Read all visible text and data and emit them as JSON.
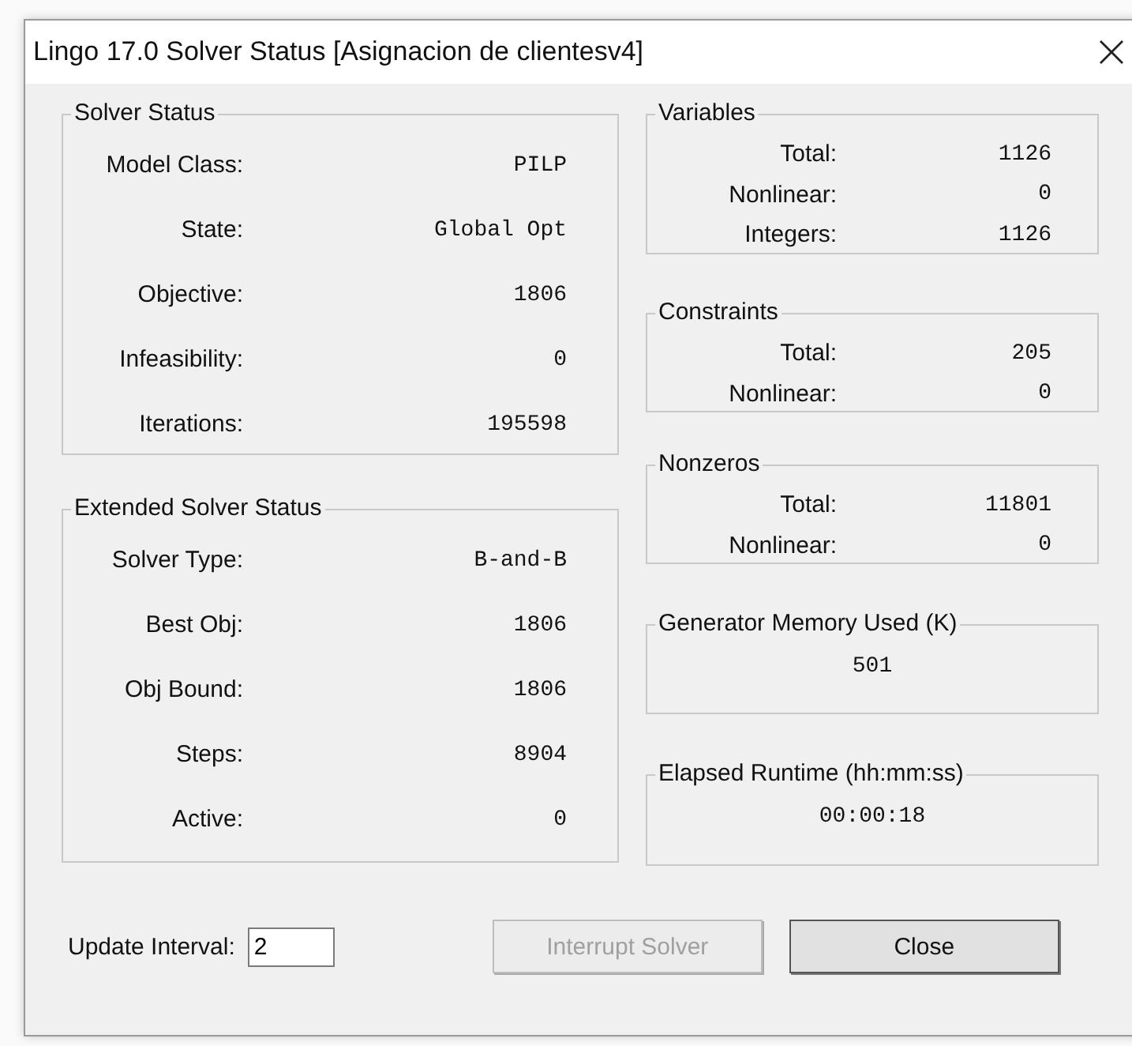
{
  "window": {
    "title": "Lingo 17.0 Solver Status [Asignacion de clientesv4]"
  },
  "left_groups": [
    {
      "title": "Solver Status",
      "rows": [
        {
          "label": "Model Class:",
          "value": "PILP"
        },
        {
          "label": "State:",
          "value": "Global Opt"
        },
        {
          "label": "Objective:",
          "value": "1806"
        },
        {
          "label": "Infeasibility:",
          "value": "0"
        },
        {
          "label": "Iterations:",
          "value": "195598"
        }
      ]
    },
    {
      "title": "Extended Solver Status",
      "rows": [
        {
          "label": "Solver Type:",
          "value": "B-and-B"
        },
        {
          "label": "Best Obj:",
          "value": "1806"
        },
        {
          "label": "Obj Bound:",
          "value": "1806"
        },
        {
          "label": "Steps:",
          "value": "8904"
        },
        {
          "label": "Active:",
          "value": "0"
        }
      ]
    }
  ],
  "right_groups": [
    {
      "kind": "rows",
      "title": "Variables",
      "rows": [
        {
          "label": "Total:",
          "value": "1126"
        },
        {
          "label": "Nonlinear:",
          "value": "0"
        },
        {
          "label": "Integers:",
          "value": "1126"
        }
      ]
    },
    {
      "kind": "rows",
      "title": "Constraints",
      "rows": [
        {
          "label": "Total:",
          "value": "205"
        },
        {
          "label": "Nonlinear:",
          "value": "0"
        }
      ]
    },
    {
      "kind": "rows",
      "title": "Nonzeros",
      "rows": [
        {
          "label": "Total:",
          "value": "11801"
        },
        {
          "label": "Nonlinear:",
          "value": "0"
        }
      ]
    },
    {
      "kind": "single",
      "title": "Generator Memory Used (K)",
      "value": "501"
    },
    {
      "kind": "single",
      "title": "Elapsed Runtime (hh:mm:ss)",
      "value": "00:00:18"
    }
  ],
  "update_interval": {
    "label": "Update Interval:",
    "value": "2"
  },
  "buttons": [
    {
      "label": "Interrupt Solver",
      "disabled": true
    },
    {
      "label": "Close",
      "disabled": false
    }
  ]
}
